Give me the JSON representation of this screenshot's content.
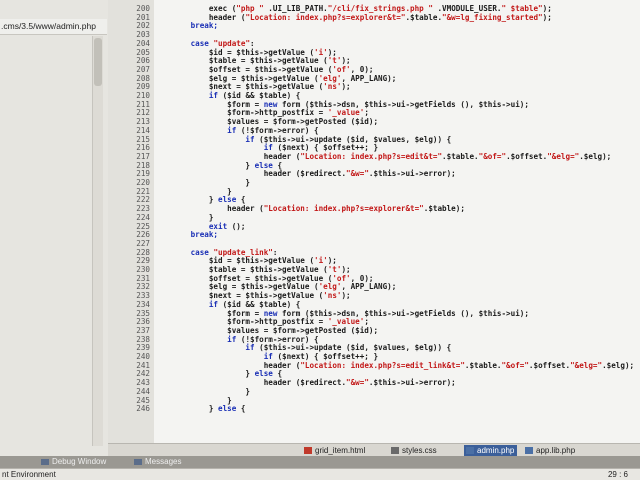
{
  "project_panel": {
    "path": ".cms/3.5/www/admin.php"
  },
  "editor": {
    "lines": [
      {
        "n": "200",
        "segs": [
          [
            "v",
            "            exec ("
          ],
          [
            "s",
            "\"php \""
          ],
          [
            "v",
            " .UI_LIB_PATH."
          ],
          [
            "s",
            "\"/cli/fix_strings.php \""
          ],
          [
            "v",
            " .VMODULE_USER."
          ],
          [
            "s",
            "\" $table\""
          ],
          [
            "v",
            ");"
          ]
        ]
      },
      {
        "n": "201",
        "segs": [
          [
            "v",
            "            header ("
          ],
          [
            "s",
            "\"Location: index.php?s=explorer&t=\""
          ],
          [
            "v",
            ".$table."
          ],
          [
            "s",
            "\"&w=lg_fixing_started\""
          ],
          [
            "v",
            ");"
          ]
        ]
      },
      {
        "n": "202",
        "segs": [
          [
            "kw",
            "        break;"
          ]
        ]
      },
      {
        "n": "203",
        "segs": [
          [
            "v",
            ""
          ]
        ]
      },
      {
        "n": "204",
        "segs": [
          [
            "kw",
            "        case "
          ],
          [
            "s",
            "\"update\""
          ],
          [
            "v",
            ":"
          ]
        ]
      },
      {
        "n": "205",
        "segs": [
          [
            "v",
            "            $id = $this->getValue ("
          ],
          [
            "s",
            "'i'"
          ],
          [
            "v",
            ");"
          ]
        ]
      },
      {
        "n": "206",
        "segs": [
          [
            "v",
            "            $table = $this->getValue ("
          ],
          [
            "s",
            "'t'"
          ],
          [
            "v",
            ");"
          ]
        ]
      },
      {
        "n": "207",
        "segs": [
          [
            "v",
            "            $offset = $this->getValue ("
          ],
          [
            "s",
            "'of'"
          ],
          [
            "v",
            ", 0);"
          ]
        ]
      },
      {
        "n": "208",
        "segs": [
          [
            "v",
            "            $elg = $this->getValue ("
          ],
          [
            "s",
            "'elg'"
          ],
          [
            "v",
            ", APP_LANG);"
          ]
        ]
      },
      {
        "n": "209",
        "segs": [
          [
            "v",
            "            $next = $this->getValue ("
          ],
          [
            "s",
            "'ns'"
          ],
          [
            "v",
            ");"
          ]
        ]
      },
      {
        "n": "210",
        "segs": [
          [
            "kw",
            "            if"
          ],
          [
            "v",
            " ($id && $table) {"
          ]
        ]
      },
      {
        "n": "211",
        "segs": [
          [
            "v",
            "                $form = "
          ],
          [
            "kw",
            "new"
          ],
          [
            "v",
            " form ($this->dsn, $this->ui->getFields (), $this->ui);"
          ]
        ]
      },
      {
        "n": "212",
        "segs": [
          [
            "v",
            "                $form->http_postfix = "
          ],
          [
            "s",
            "'_value'"
          ],
          [
            "v",
            ";"
          ]
        ]
      },
      {
        "n": "213",
        "segs": [
          [
            "v",
            "                $values = $form->getPosted ($id);"
          ]
        ]
      },
      {
        "n": "214",
        "segs": [
          [
            "kw",
            "                if"
          ],
          [
            "v",
            " (!$form->error) {"
          ]
        ]
      },
      {
        "n": "215",
        "segs": [
          [
            "kw",
            "                    if"
          ],
          [
            "v",
            " ($this->ui->update ($id, $values, $elg)) {"
          ]
        ]
      },
      {
        "n": "216",
        "segs": [
          [
            "kw",
            "                        if"
          ],
          [
            "v",
            " ($next) { $offset++; }"
          ]
        ]
      },
      {
        "n": "217",
        "segs": [
          [
            "v",
            "                        header ("
          ],
          [
            "s",
            "\"Location: index.php?s=edit&t=\""
          ],
          [
            "v",
            ".$table."
          ],
          [
            "s",
            "\"&of=\""
          ],
          [
            "v",
            ".$offset."
          ],
          [
            "s",
            "\"&elg=\""
          ],
          [
            "v",
            ".$elg);"
          ]
        ]
      },
      {
        "n": "218",
        "segs": [
          [
            "v",
            "                    } "
          ],
          [
            "kw",
            "else"
          ],
          [
            "v",
            " {"
          ]
        ]
      },
      {
        "n": "219",
        "segs": [
          [
            "v",
            "                        header ($redirect."
          ],
          [
            "s",
            "\"&w=\""
          ],
          [
            "v",
            ".$this->ui->error);"
          ]
        ]
      },
      {
        "n": "220",
        "segs": [
          [
            "v",
            "                    }"
          ]
        ]
      },
      {
        "n": "221",
        "segs": [
          [
            "v",
            "                }"
          ]
        ]
      },
      {
        "n": "222",
        "segs": [
          [
            "v",
            "            } "
          ],
          [
            "kw",
            "else"
          ],
          [
            "v",
            " {"
          ]
        ]
      },
      {
        "n": "223",
        "segs": [
          [
            "v",
            "                header ("
          ],
          [
            "s",
            "\"Location: index.php?s=explorer&t=\""
          ],
          [
            "v",
            ".$table);"
          ]
        ]
      },
      {
        "n": "224",
        "segs": [
          [
            "v",
            "            }"
          ]
        ]
      },
      {
        "n": "225",
        "segs": [
          [
            "kw",
            "            exit"
          ],
          [
            "v",
            " ();"
          ]
        ]
      },
      {
        "n": "226",
        "segs": [
          [
            "kw",
            "        break;"
          ]
        ]
      },
      {
        "n": "227",
        "segs": [
          [
            "v",
            ""
          ]
        ]
      },
      {
        "n": "228",
        "segs": [
          [
            "kw",
            "        case "
          ],
          [
            "s",
            "\"update_link\""
          ],
          [
            "v",
            ":"
          ]
        ]
      },
      {
        "n": "229",
        "segs": [
          [
            "v",
            "            $id = $this->getValue ("
          ],
          [
            "s",
            "'i'"
          ],
          [
            "v",
            ");"
          ]
        ]
      },
      {
        "n": "230",
        "segs": [
          [
            "v",
            "            $table = $this->getValue ("
          ],
          [
            "s",
            "'t'"
          ],
          [
            "v",
            ");"
          ]
        ]
      },
      {
        "n": "231",
        "segs": [
          [
            "v",
            "            $offset = $this->getValue ("
          ],
          [
            "s",
            "'of'"
          ],
          [
            "v",
            ", 0);"
          ]
        ]
      },
      {
        "n": "232",
        "segs": [
          [
            "v",
            "            $elg = $this->getValue ("
          ],
          [
            "s",
            "'elg'"
          ],
          [
            "v",
            ", APP_LANG);"
          ]
        ]
      },
      {
        "n": "233",
        "segs": [
          [
            "v",
            "            $next = $this->getValue ("
          ],
          [
            "s",
            "'ns'"
          ],
          [
            "v",
            ");"
          ]
        ]
      },
      {
        "n": "234",
        "segs": [
          [
            "kw",
            "            if"
          ],
          [
            "v",
            " ($id && $table) {"
          ]
        ]
      },
      {
        "n": "235",
        "segs": [
          [
            "v",
            "                $form = "
          ],
          [
            "kw",
            "new"
          ],
          [
            "v",
            " form ($this->dsn, $this->ui->getFields (), $this->ui);"
          ]
        ]
      },
      {
        "n": "236",
        "segs": [
          [
            "v",
            "                $form->http_postfix = "
          ],
          [
            "s",
            "'_value'"
          ],
          [
            "v",
            ";"
          ]
        ]
      },
      {
        "n": "237",
        "segs": [
          [
            "v",
            "                $values = $form->getPosted ($id);"
          ]
        ]
      },
      {
        "n": "238",
        "segs": [
          [
            "kw",
            "                if"
          ],
          [
            "v",
            " (!$form->error) {"
          ]
        ]
      },
      {
        "n": "239",
        "segs": [
          [
            "kw",
            "                    if"
          ],
          [
            "v",
            " ($this->ui->update ($id, $values, $elg)) {"
          ]
        ]
      },
      {
        "n": "240",
        "segs": [
          [
            "kw",
            "                        if"
          ],
          [
            "v",
            " ($next) { $offset++; }"
          ]
        ]
      },
      {
        "n": "241",
        "segs": [
          [
            "v",
            "                        header ("
          ],
          [
            "s",
            "\"Location: index.php?s=edit_link&t=\""
          ],
          [
            "v",
            ".$table."
          ],
          [
            "s",
            "\"&of=\""
          ],
          [
            "v",
            ".$offset."
          ],
          [
            "s",
            "\"&elg=\""
          ],
          [
            "v",
            ".$elg);"
          ]
        ]
      },
      {
        "n": "242",
        "segs": [
          [
            "v",
            "                    } "
          ],
          [
            "kw",
            "else"
          ],
          [
            "v",
            " {"
          ]
        ]
      },
      {
        "n": "243",
        "segs": [
          [
            "v",
            "                        header ($redirect."
          ],
          [
            "s",
            "\"&w=\""
          ],
          [
            "v",
            ".$this->ui->error);"
          ]
        ]
      },
      {
        "n": "244",
        "segs": [
          [
            "v",
            "                    }"
          ]
        ]
      },
      {
        "n": "245",
        "segs": [
          [
            "v",
            "                }"
          ]
        ]
      },
      {
        "n": "246",
        "segs": [
          [
            "v",
            "            } "
          ],
          [
            "kw",
            "else"
          ],
          [
            "v",
            " {"
          ]
        ]
      }
    ]
  },
  "file_tabs": [
    {
      "label": "grid_item.html",
      "icon": "html-file-icon",
      "active": false
    },
    {
      "label": "styles.css",
      "icon": "css-file-icon",
      "active": false
    },
    {
      "label": "admin.php",
      "icon": "php-file-icon",
      "active": true
    },
    {
      "label": "app.lib.php",
      "icon": "php-file-icon",
      "active": false
    }
  ],
  "bottom_tabs": [
    {
      "label": "Debug Window",
      "icon": "debug-window-icon"
    },
    {
      "label": "Messages",
      "icon": "messages-icon"
    }
  ],
  "status": {
    "left": "nt Environment",
    "position": "29 : 6"
  },
  "colors": {
    "keyword": "#1a2fb5",
    "string": "#c21818",
    "active_tab": "#3b5f9a"
  }
}
